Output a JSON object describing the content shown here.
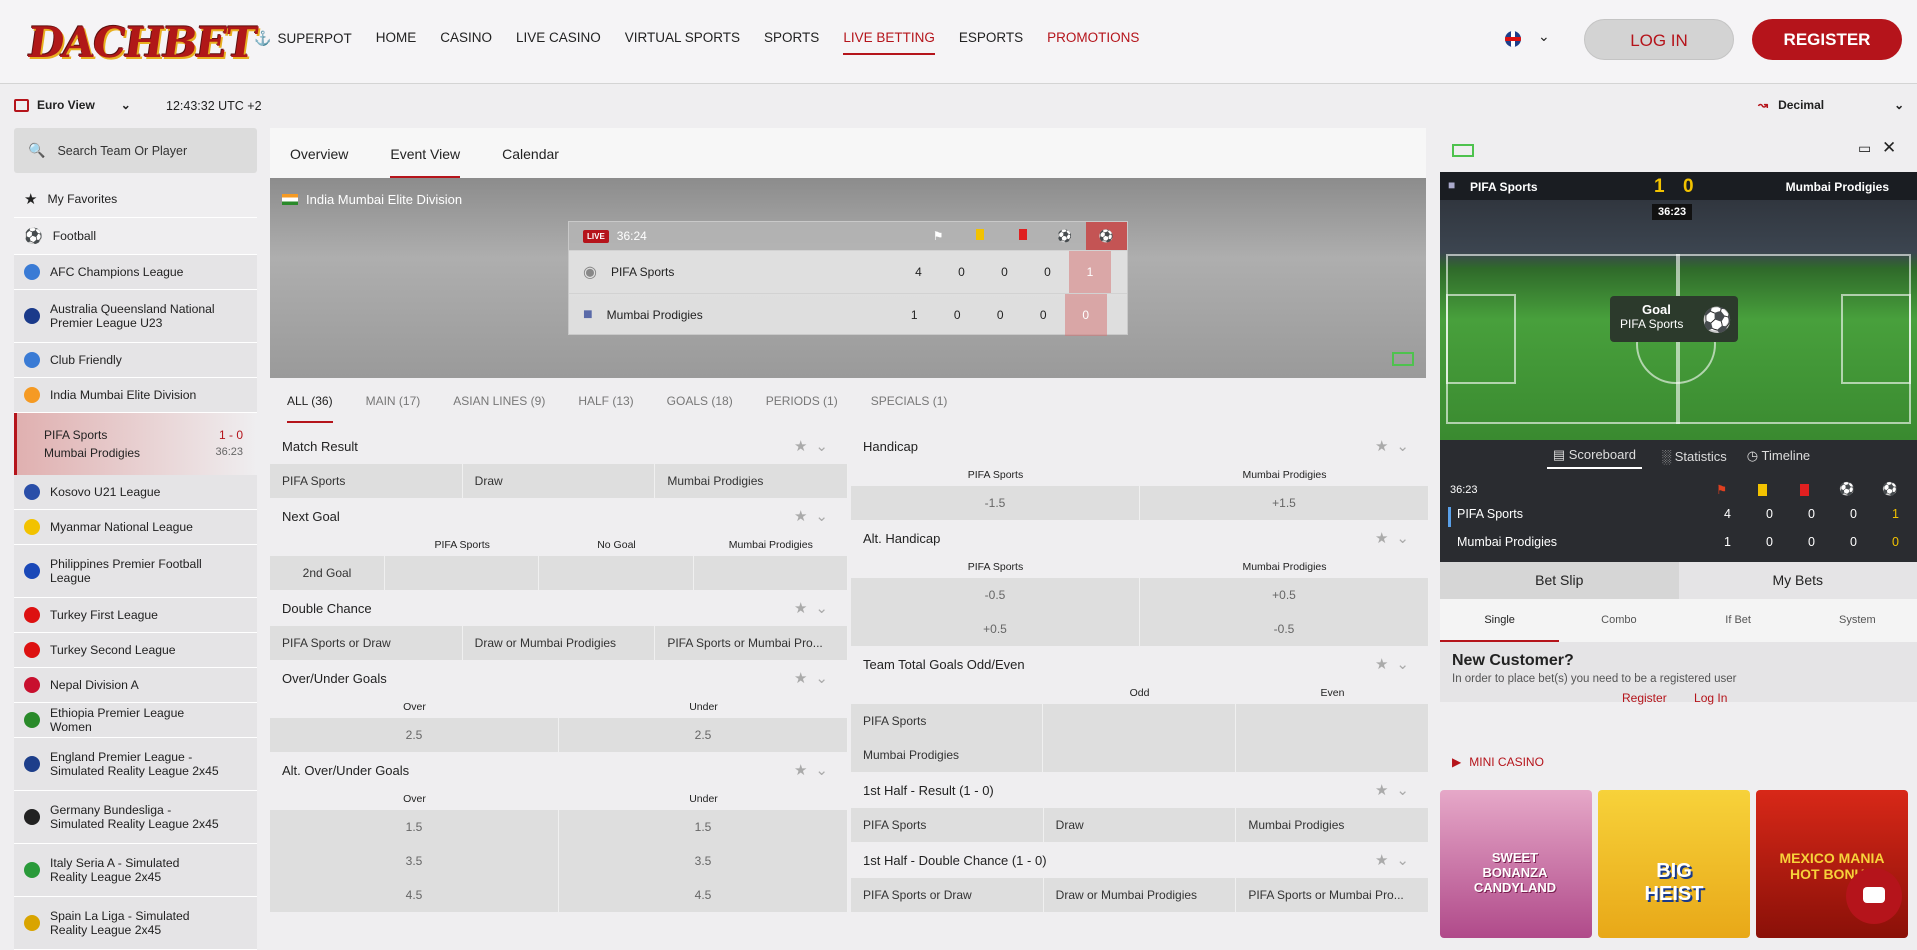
{
  "header": {
    "logo": "DACHBET",
    "nav": [
      "SUPERPOT",
      "HOME",
      "CASINO",
      "LIVE CASINO",
      "VIRTUAL SPORTS",
      "SPORTS",
      "LIVE BETTING",
      "ESPORTS",
      "PROMOTIONS"
    ],
    "active_nav": "LIVE BETTING",
    "login": "LOG IN",
    "register": "REGISTER"
  },
  "subbar": {
    "view": "Euro View",
    "time": "12:43:32 UTC +2",
    "odds_format": "Decimal"
  },
  "sidebar": {
    "search_placeholder": "Search Team Or Player",
    "favorites": "My Favorites",
    "sport": "Football",
    "leagues": [
      {
        "name": "AFC Champions League",
        "color": "#3a7bd5"
      },
      {
        "name": "Australia Queensland National Premier League U23",
        "color": "#1a3a8a"
      },
      {
        "name": "Club Friendly",
        "color": "#3a7bd5"
      },
      {
        "name": "India Mumbai Elite Division",
        "color": "#f59a23"
      }
    ],
    "live_match": {
      "home": "PIFA Sports",
      "away": "Mumbai Prodigies",
      "score": "1 - 0",
      "time": "36:23"
    },
    "leagues2": [
      {
        "name": "Kosovo U21 League",
        "color": "#2a4ea8"
      },
      {
        "name": "Myanmar National League",
        "color": "#f2c200"
      },
      {
        "name": "Philippines Premier Football League",
        "color": "#1a48b8"
      },
      {
        "name": "Turkey First League",
        "color": "#d11"
      },
      {
        "name": "Turkey Second League",
        "color": "#d11"
      },
      {
        "name": "Nepal Division A",
        "color": "#c8102e"
      },
      {
        "name": "Ethiopia Premier League Women",
        "color": "#2a8a2a"
      },
      {
        "name": "England Premier League - Simulated Reality League 2x45",
        "color": "#1d3e8a"
      },
      {
        "name": "Germany Bundesliga - Simulated Reality League 2x45",
        "color": "#222"
      },
      {
        "name": "Italy Seria A - Simulated Reality League 2x45",
        "color": "#2a9a3a"
      },
      {
        "name": "Spain La Liga - Simulated Reality League 2x45",
        "color": "#d9a400"
      }
    ]
  },
  "main": {
    "tabs": [
      "Overview",
      "Event View",
      "Calendar"
    ],
    "active_tab": "Event View",
    "league": "India Mumbai Elite Division",
    "scoreboard": {
      "live": "LIVE",
      "time": "36:24",
      "rows": [
        {
          "team": "PIFA Sports",
          "corners": "4",
          "yellow": "0",
          "red": "0",
          "pen": "0",
          "goals": "1"
        },
        {
          "team": "Mumbai Prodigies",
          "corners": "1",
          "yellow": "0",
          "red": "0",
          "pen": "0",
          "goals": "0"
        }
      ]
    },
    "market_tabs": [
      "ALL (36)",
      "MAIN (17)",
      "ASIAN LINES (9)",
      "HALF (13)",
      "GOALS (18)",
      "PERIODS (1)",
      "SPECIALS (1)"
    ],
    "left": {
      "match_result": {
        "title": "Match Result",
        "odds": [
          "PIFA Sports",
          "Draw",
          "Mumbai Prodigies"
        ]
      },
      "next_goal": {
        "title": "Next Goal",
        "cols": [
          "PIFA Sports",
          "No Goal",
          "Mumbai Prodigies"
        ],
        "row": "2nd Goal"
      },
      "double_chance": {
        "title": "Double Chance",
        "odds": [
          "PIFA Sports or Draw",
          "Draw or Mumbai Prodigies",
          "PIFA Sports or Mumbai Pro..."
        ]
      },
      "over_under": {
        "title": "Over/Under Goals",
        "cols": [
          "Over",
          "Under"
        ],
        "rows": [
          [
            "2.5",
            "2.5"
          ]
        ]
      },
      "alt_over_under": {
        "title": "Alt. Over/Under Goals",
        "cols": [
          "Over",
          "Under"
        ],
        "rows": [
          [
            "1.5",
            "1.5"
          ],
          [
            "3.5",
            "3.5"
          ],
          [
            "4.5",
            "4.5"
          ]
        ]
      }
    },
    "right": {
      "handicap": {
        "title": "Handicap",
        "cols": [
          "PIFA Sports",
          "Mumbai Prodigies"
        ],
        "rows": [
          [
            "-1.5",
            "+1.5"
          ]
        ]
      },
      "alt_handicap": {
        "title": "Alt. Handicap",
        "cols": [
          "PIFA Sports",
          "Mumbai Prodigies"
        ],
        "rows": [
          [
            "-0.5",
            "+0.5"
          ],
          [
            "+0.5",
            "-0.5"
          ]
        ]
      },
      "team_total": {
        "title": "Team Total Goals Odd/Even",
        "cols": [
          "Odd",
          "Even"
        ],
        "rows": [
          "PIFA Sports",
          "Mumbai Prodigies"
        ]
      },
      "first_half": {
        "title": "1st Half - Result  (1 - 0)",
        "odds": [
          "PIFA Sports",
          "Draw",
          "Mumbai Prodigies"
        ]
      },
      "first_half_dc": {
        "title": "1st Half - Double Chance  (1 - 0)",
        "odds": [
          "PIFA Sports or Draw",
          "Draw or Mumbai Prodigies",
          "PIFA Sports or Mumbai Pro..."
        ]
      }
    }
  },
  "right_panel": {
    "video": {
      "home": "PIFA Sports",
      "away": "Mumbai Prodigies",
      "home_score": "1",
      "away_score": "0",
      "time": "36:23",
      "event": "Goal",
      "event_team": "PIFA Sports"
    },
    "tabs": [
      "Scoreboard",
      "Statistics",
      "Timeline"
    ],
    "stats": {
      "time": "36:23",
      "rows": [
        {
          "team": "PIFA Sports",
          "v": [
            "4",
            "0",
            "0",
            "0",
            "1"
          ]
        },
        {
          "team": "Mumbai Prodigies",
          "v": [
            "1",
            "0",
            "0",
            "0",
            "0"
          ]
        }
      ]
    },
    "slip_tabs": [
      "Bet Slip",
      "My Bets"
    ],
    "slip_sub": [
      "Single",
      "Combo",
      "If Bet",
      "System"
    ],
    "new_customer": "New Customer?",
    "new_customer_text": "In order to place bet(s) you need to be a registered user",
    "register_link": "Register",
    "login_link": "Log In",
    "mini_casino": "MINI CASINO",
    "games": [
      "SWEET BONANZA CANDYLAND",
      "BIG HEIST",
      "MEXICO MANIA HOT BONUS"
    ]
  }
}
